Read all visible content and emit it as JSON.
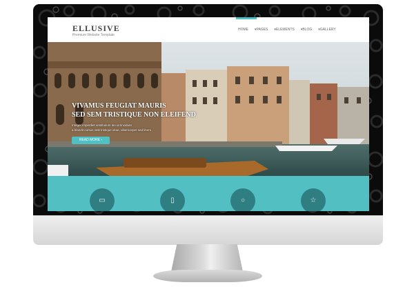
{
  "site": {
    "logo": "ELLUSIVE",
    "tagline": "Premium Website Template"
  },
  "nav": [
    "HOME",
    "PAGES",
    "ELEMENTS",
    "BLOG",
    "GALLERY"
  ],
  "hero": {
    "title_line1": "VIVAMUS FEUGIAT MAURIS",
    "title_line2": "SED SEM TRISTIQUE NON ELEIFEND",
    "text_line1": "Integer imperdiet vestibulum leo ut tincidunt",
    "text_line2": "a blandit cursus velit tristique vitae, ullamcorper sed libero",
    "button": "READ MORE"
  },
  "colors": {
    "accent": "#4fc0c4",
    "band": "#52bfc2",
    "circle": "#2f7f82"
  },
  "features": [
    {
      "icon": "desktop-icon",
      "glyph": "▭"
    },
    {
      "icon": "mobile-icon",
      "glyph": "▯"
    },
    {
      "icon": "search-icon",
      "glyph": "○"
    },
    {
      "icon": "star-icon",
      "glyph": "☆"
    }
  ]
}
